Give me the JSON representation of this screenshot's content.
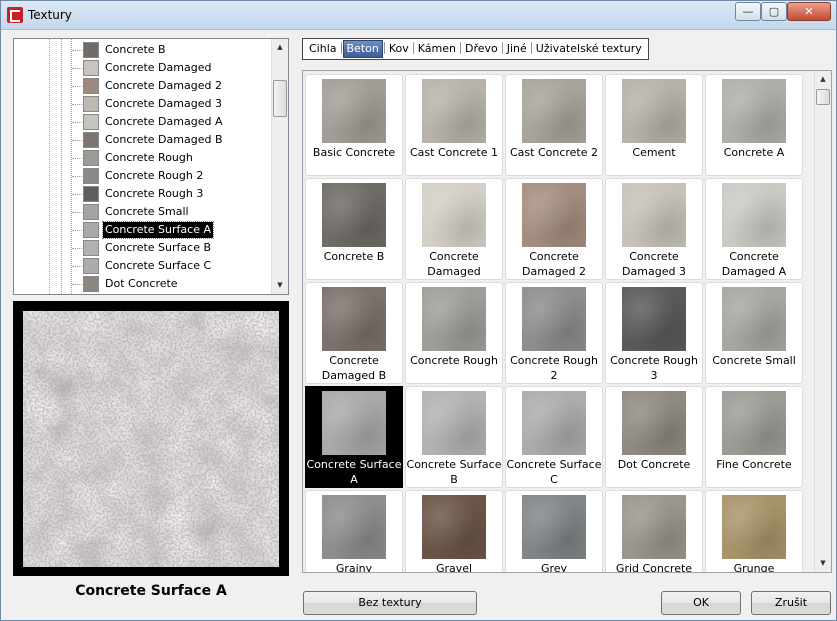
{
  "window": {
    "title": "Textury",
    "minimize_label": "—",
    "maximize_label": "▢",
    "close_label": "✕"
  },
  "tree": {
    "items": [
      {
        "label": "Concrete B",
        "color": "#6f6b66"
      },
      {
        "label": "Concrete Damaged",
        "color": "#c9c5bc"
      },
      {
        "label": "Concrete Damaged 2",
        "color": "#9c8a7e"
      },
      {
        "label": "Concrete Damaged 3",
        "color": "#bdb9b0"
      },
      {
        "label": "Concrete Damaged A",
        "color": "#c7c4be"
      },
      {
        "label": "Concrete Damaged B",
        "color": "#7d7470"
      },
      {
        "label": "Concrete Rough",
        "color": "#9a9a96"
      },
      {
        "label": "Concrete Rough 2",
        "color": "#8a8a88"
      },
      {
        "label": "Concrete Rough 3",
        "color": "#5e5e5e"
      },
      {
        "label": "Concrete Small",
        "color": "#a3a3a0"
      },
      {
        "label": "Concrete Surface A",
        "color": "#a9a9a9"
      },
      {
        "label": "Concrete Surface B",
        "color": "#b1b1b1"
      },
      {
        "label": "Concrete Surface C",
        "color": "#ababab"
      },
      {
        "label": "Dot Concrete",
        "color": "#8b8680"
      }
    ],
    "selected_index": 10
  },
  "preview": {
    "caption": "Concrete Surface A"
  },
  "tabs": {
    "items": [
      "Cihla",
      "Beton",
      "Kov",
      "Kámen",
      "Dřevo",
      "Jiné",
      "Uživatelské textury"
    ],
    "active_index": 1
  },
  "grid": {
    "items": [
      {
        "label": "Basic Concrete",
        "color": "#a09e96"
      },
      {
        "label": "Cast Concrete 1",
        "color": "#b7b3aa"
      },
      {
        "label": "Cast Concrete 2",
        "color": "#a8a49c"
      },
      {
        "label": "Cement",
        "color": "#b5b2a8"
      },
      {
        "label": "Concrete A",
        "color": "#b0aeaa"
      },
      {
        "label": "Concrete B",
        "color": "#6f6b66"
      },
      {
        "label": "Concrete Damaged",
        "color": "#d3cfc7"
      },
      {
        "label": "Concrete Damaged 2",
        "color": "#a48d80"
      },
      {
        "label": "Concrete Damaged 3",
        "color": "#c6c2b9"
      },
      {
        "label": "Concrete Damaged A",
        "color": "#cbc9c4"
      },
      {
        "label": "Concrete Damaged B",
        "color": "#7c716c"
      },
      {
        "label": "Concrete Rough",
        "color": "#9e9d99"
      },
      {
        "label": "Concrete Rough 2",
        "color": "#8d8d8b"
      },
      {
        "label": "Concrete Rough 3",
        "color": "#5a5a5a"
      },
      {
        "label": "Concrete Small",
        "color": "#a7a6a3"
      },
      {
        "label": "Concrete Surface A",
        "color": "#a9a9a9"
      },
      {
        "label": "Concrete Surface B",
        "color": "#b2b2b2"
      },
      {
        "label": "Concrete Surface C",
        "color": "#acacac"
      },
      {
        "label": "Dot Concrete",
        "color": "#8f8a82"
      },
      {
        "label": "Fine Concrete",
        "color": "#9d9b96"
      },
      {
        "label": "Grainy",
        "color": "#8d8d8d"
      },
      {
        "label": "Gravel",
        "color": "#6b5548"
      },
      {
        "label": "Grey",
        "color": "#818587"
      },
      {
        "label": "Grid Concrete",
        "color": "#9a958d"
      },
      {
        "label": "Grunge",
        "color": "#a8946a"
      }
    ],
    "selected_index": 15
  },
  "buttons": {
    "no_texture": "Bez textury",
    "ok": "OK",
    "cancel": "Zrušit"
  },
  "colors": {
    "selection": "#000000",
    "tab_active": "#3d5d94"
  }
}
